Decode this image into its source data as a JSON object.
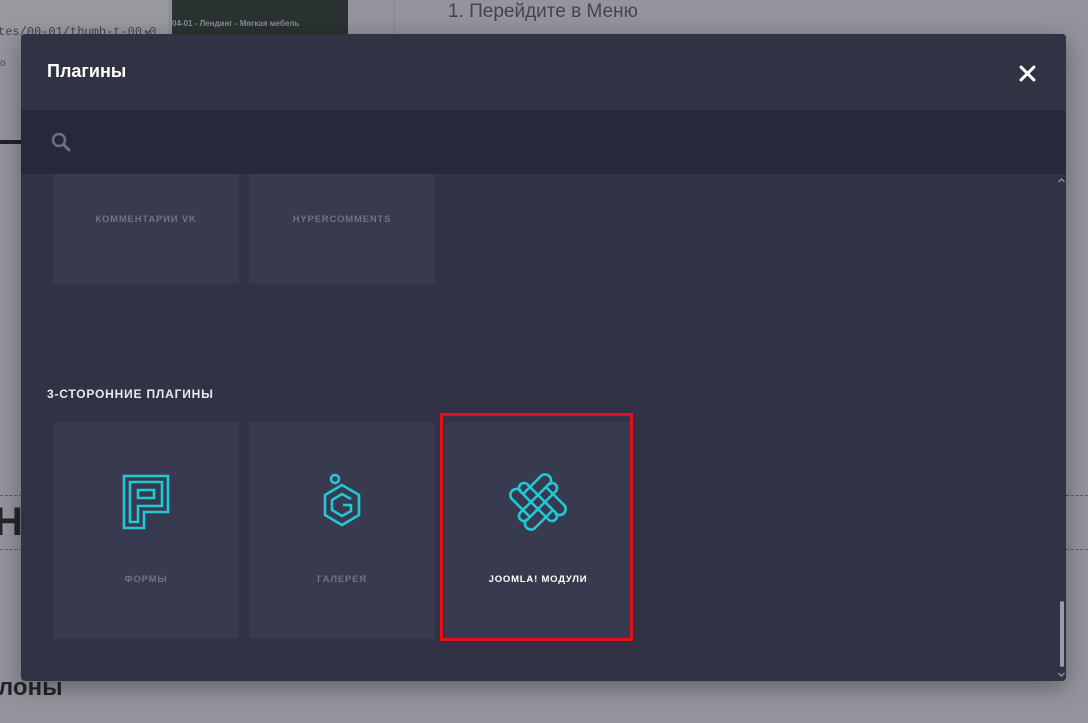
{
  "background": {
    "path_text": "tes/00-01/thumb-t-00-0",
    "path_close": "×",
    "path_sub": "о",
    "thumb_caption": "04-01 - Лендинг - Мягкая мебель",
    "step_text": "1. Перейдите в Меню",
    "big_letter": "Н",
    "bottom_word": "лоны"
  },
  "modal": {
    "title": "Плагины",
    "close_icon": "close-icon",
    "search": {
      "placeholder": "",
      "value": "",
      "icon": "search-icon"
    },
    "top_tiles": [
      {
        "label": "КОММЕНТАРИИ VK"
      },
      {
        "label": "HYPERCOMMENTS"
      }
    ],
    "section_title": "3-СТОРОННИЕ ПЛАГИНЫ",
    "third_party_tiles": [
      {
        "label": "ФОРМЫ",
        "icon": "forms-icon",
        "active": false
      },
      {
        "label": "ГАЛЕРЕЯ",
        "icon": "gallery-icon",
        "active": false
      },
      {
        "label": "JOOMLA! МОДУЛИ",
        "icon": "joomla-icon",
        "active": true
      }
    ],
    "colors": {
      "accent": "#1fc9d6",
      "highlight": "#e0121b",
      "modal_bg": "#313345",
      "tile_bg": "#383b4f"
    }
  }
}
